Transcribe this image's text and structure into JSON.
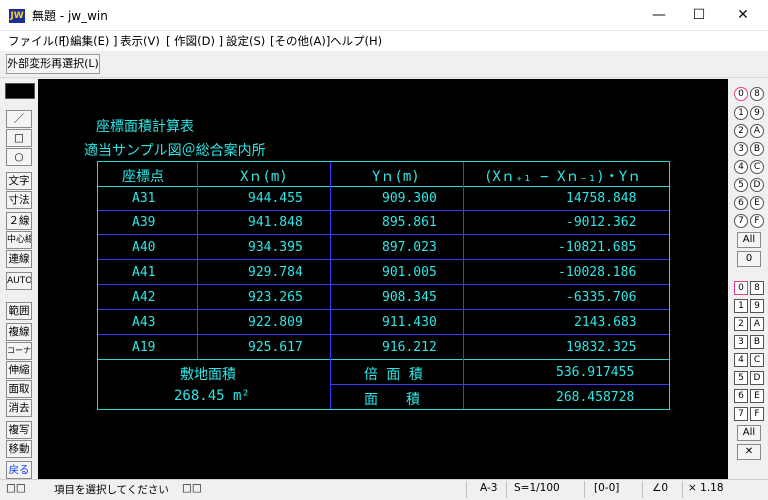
{
  "window": {
    "app_icon_text": "JW",
    "title": "無題 - jw_win",
    "minimize_glyph": "—",
    "maximize_glyph": "☐",
    "close_glyph": "✕"
  },
  "menu": [
    "ファイル(F)",
    "[ 編集(E) ]",
    "表示(V)",
    "[ 作図(D) ]",
    "設定(S)",
    "[その他(A)]",
    "ヘルプ(H)"
  ],
  "toolbar": {
    "reselect_label": "外部変形再選択(L)"
  },
  "left_tools": [
    "／",
    "□",
    "○",
    "文字",
    "寸法",
    "２線",
    "中心線",
    "連線",
    "AUTO",
    "範囲",
    "複線",
    "コーナー",
    "伸縮",
    "面取",
    "消去",
    "複写",
    "移動",
    "戻る"
  ],
  "right_palette": {
    "circles_left": [
      "0",
      "1",
      "2",
      "3",
      "4",
      "5",
      "6",
      "7"
    ],
    "circles_right": [
      "8",
      "9",
      "A",
      "B",
      "C",
      "D",
      "E",
      "F"
    ],
    "all_label": "All",
    "zero_label": "0",
    "squares_left": [
      "0",
      "1",
      "2",
      "3",
      "4",
      "5",
      "6",
      "7"
    ],
    "squares_right": [
      "8",
      "9",
      "A",
      "B",
      "C",
      "D",
      "E",
      "F"
    ],
    "all2_label": "All",
    "x_label": "✕"
  },
  "drawing": {
    "title1": "座標面積計算表",
    "title2": "適当サンプル図＠総合案内所",
    "headers": [
      "座標点",
      "Xｎ(m)",
      "Yｎ(m)",
      "(Xｎ₊₁ − Xｎ₋₁)・Yｎ"
    ],
    "rows": [
      {
        "point": "A31",
        "x": "944.455",
        "y": "909.300",
        "v": "14758.848"
      },
      {
        "point": "A39",
        "x": "941.848",
        "y": "895.861",
        "v": "-9012.362"
      },
      {
        "point": "A40",
        "x": "934.395",
        "y": "897.023",
        "v": "-10821.685"
      },
      {
        "point": "A41",
        "x": "929.784",
        "y": "901.005",
        "v": "-10028.186"
      },
      {
        "point": "A42",
        "x": "923.265",
        "y": "908.345",
        "v": "-6335.706"
      },
      {
        "point": "A43",
        "x": "922.809",
        "y": "911.430",
        "v": "2143.683"
      },
      {
        "point": "A19",
        "x": "925.617",
        "y": "916.212",
        "v": "19832.325"
      }
    ],
    "site_area_label": "敷地面積",
    "site_area_value": "268.45 m²",
    "double_area_label": "倍 面 積",
    "double_area_value": "536.917455",
    "area_label": "面　　積",
    "area_value": "268.458728"
  },
  "status": {
    "left_icon": "□□",
    "prompt": "項目を選択してください",
    "mid_icon": "□□",
    "paper": "A-3",
    "scale": "S=1/100",
    "layer": "[0-0]",
    "angle": "∠0",
    "zoom": "× 1.18"
  }
}
